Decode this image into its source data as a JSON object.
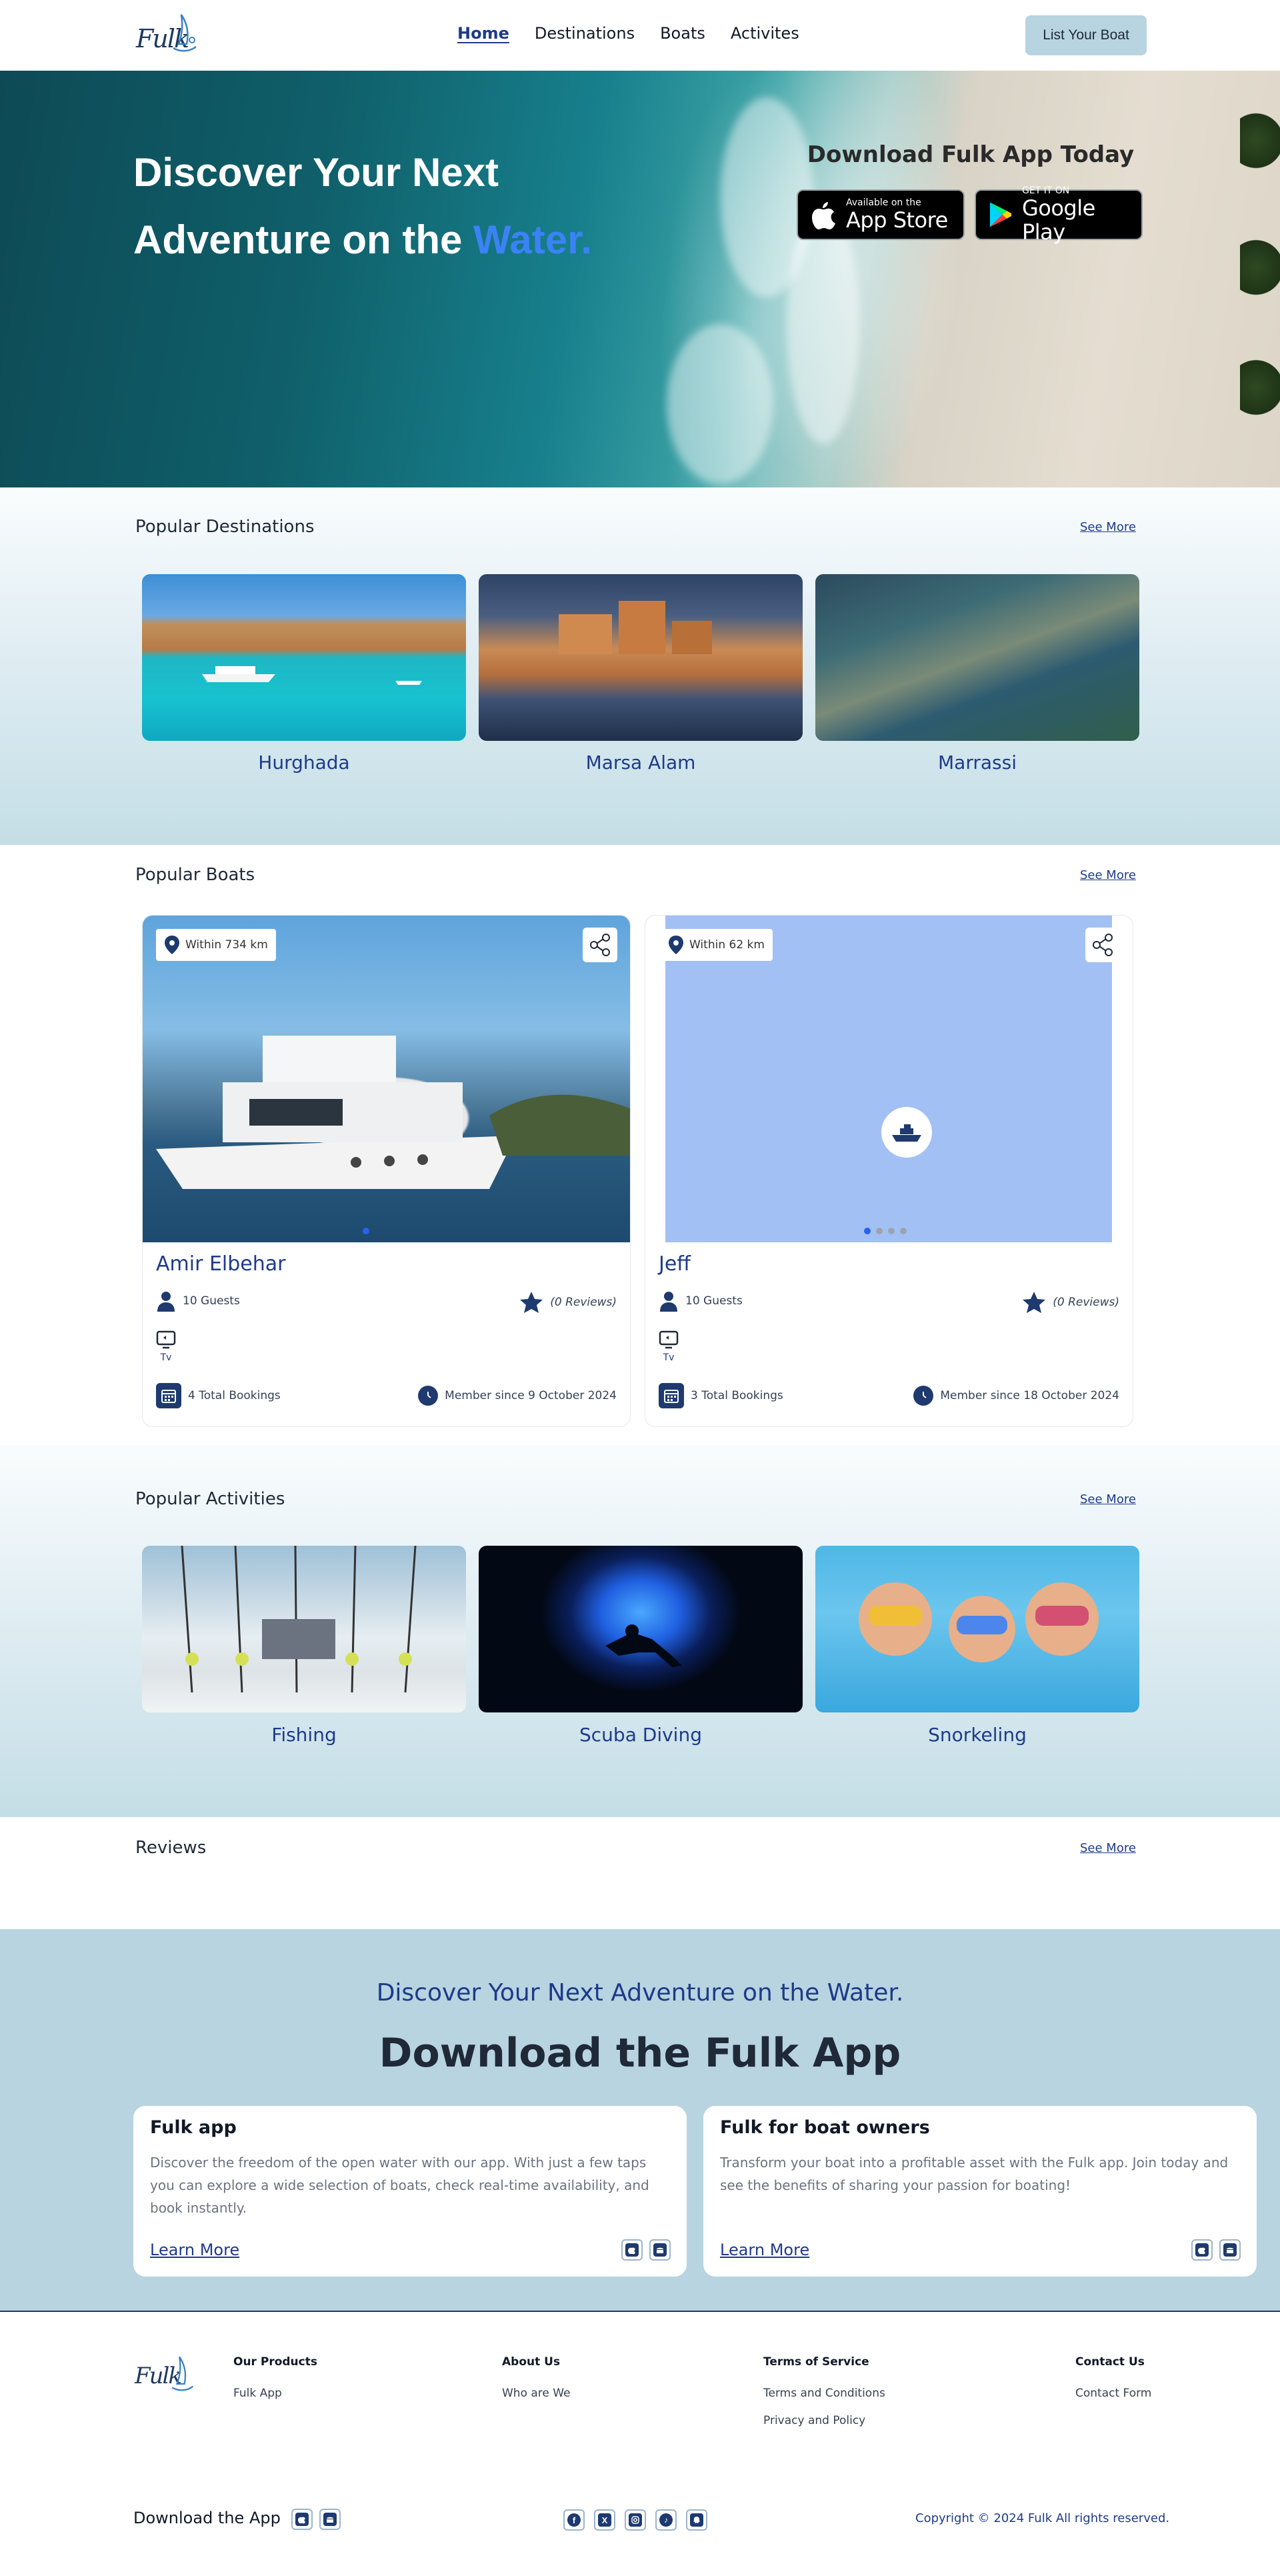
{
  "header": {
    "logo_text": "Fulk",
    "nav": [
      "Home",
      "Destinations",
      "Boats",
      "Activites"
    ],
    "list_boat_label": "List Your Boat"
  },
  "hero": {
    "title_line1": "Discover Your Next",
    "title_line2_start": "Adventure on the ",
    "title_accent": "Water.",
    "download_title": "Download Fulk App Today",
    "app_store_small": "Available on the",
    "app_store_big": "App Store",
    "google_play_small": "GET IT ON",
    "google_play_big": "Google Play"
  },
  "destinations": {
    "heading": "Popular Destinations",
    "see_more": "See More",
    "items": [
      {
        "name": "Hurghada"
      },
      {
        "name": "Marsa Alam"
      },
      {
        "name": "Marrassi"
      }
    ]
  },
  "boats": {
    "heading": "Popular Boats",
    "see_more": "See More",
    "items": [
      {
        "name": "Amir Elbehar",
        "distance": "Within 734 km",
        "guests": "10 Guests",
        "reviews": "(0 Reviews)",
        "amenity": "Tv",
        "bookings": "4 Total Bookings",
        "member_since": "Member since 9 October 2024"
      },
      {
        "name": "Jeff",
        "distance": "Within 62 km",
        "guests": "10 Guests",
        "reviews": "(0 Reviews)",
        "amenity": "Tv",
        "bookings": "3 Total Bookings",
        "member_since": "Member since 18 October 2024"
      }
    ]
  },
  "activities": {
    "heading": "Popular Activities",
    "see_more": "See More",
    "items": [
      {
        "name": "Fishing"
      },
      {
        "name": "Scuba Diving"
      },
      {
        "name": "Snorkeling"
      }
    ]
  },
  "reviews": {
    "heading": "Reviews",
    "see_more": "See More"
  },
  "download": {
    "subtitle": "Discover Your Next Adventure on the Water.",
    "title": "Download the Fulk App",
    "cards": [
      {
        "title": "Fulk app",
        "desc": "Discover the freedom of the open water with our app. With just a few taps you can explore a wide selection of boats, check real-time availability, and book instantly.",
        "link": "Learn More"
      },
      {
        "title": "Fulk for boat owners",
        "desc": "Transform your boat into a profitable asset with the Fulk app. Join today and see the benefits of sharing your passion for boating!",
        "link": "Learn More"
      }
    ]
  },
  "footer": {
    "logo_text": "Fulk",
    "col1_title": "Our Products",
    "col1_links": [
      "Fulk App"
    ],
    "col2_title": "About Us",
    "col2_links": [
      "Who are We"
    ],
    "col3_title": "Terms of Service",
    "col3_links": [
      "Terms and Conditions",
      "Privacy and Policy"
    ],
    "col4_title": "Contact Us",
    "col4_links": [
      "Contact Form"
    ],
    "download_label": "Download the App",
    "copyright": "Copyright © 2024 Fulk All rights reserved.",
    "social_icons": [
      "facebook-icon",
      "x-icon",
      "instagram-icon",
      "tiktok-icon",
      "snapchat-icon"
    ]
  },
  "colors": {
    "brand_navy": "#1e3a8a",
    "accent_blue": "#3b82f6",
    "light_blue": "#b7d4e0"
  }
}
